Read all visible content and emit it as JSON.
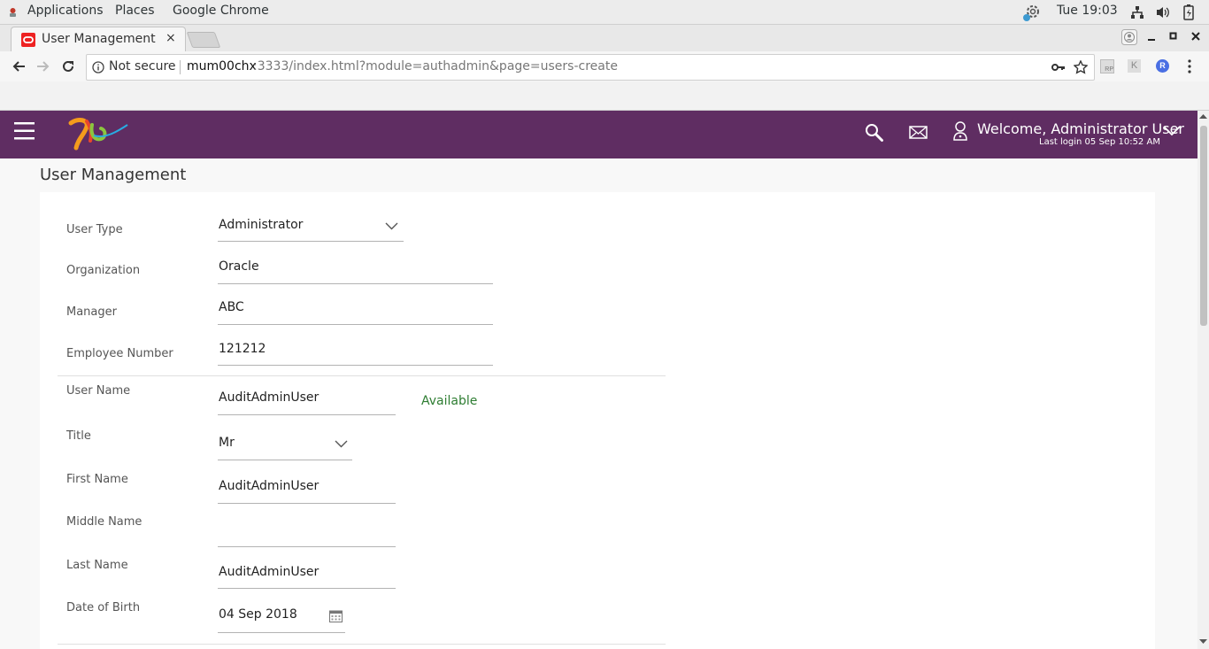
{
  "os": {
    "menus": [
      "Applications",
      "Places",
      "Google Chrome"
    ],
    "clock": "Tue 19:03"
  },
  "browser": {
    "tab_title": "User Management - ",
    "close_glyph": "×",
    "security_label": "Not secure",
    "url_host": "mum00chx",
    "url_rest": ":3333/index.html?module=authadmin&page=users-create",
    "ext_labels": [
      "RP",
      "K",
      "R"
    ]
  },
  "app": {
    "welcome": "Welcome, Administrator User",
    "last_login": "Last login 05 Sep 10:52 AM",
    "page_title": "User Management"
  },
  "form": {
    "user_type": {
      "label": "User Type",
      "value": "Administrator"
    },
    "organization": {
      "label": "Organization",
      "value": "Oracle"
    },
    "manager": {
      "label": "Manager",
      "value": "ABC"
    },
    "employee_number": {
      "label": "Employee Number",
      "value": "121212"
    },
    "user_name": {
      "label": "User Name",
      "value": "AuditAdminUser",
      "status": "Available"
    },
    "title": {
      "label": "Title",
      "value": "Mr"
    },
    "first_name": {
      "label": "First Name",
      "value": "AuditAdminUser"
    },
    "middle_name": {
      "label": "Middle Name",
      "value": ""
    },
    "last_name": {
      "label": "Last Name",
      "value": "AuditAdminUser"
    },
    "date_of_birth": {
      "label": "Date of Birth",
      "value": "04 Sep 2018"
    }
  },
  "colors": {
    "header": "#5f2d62",
    "available": "#2e7d32"
  }
}
